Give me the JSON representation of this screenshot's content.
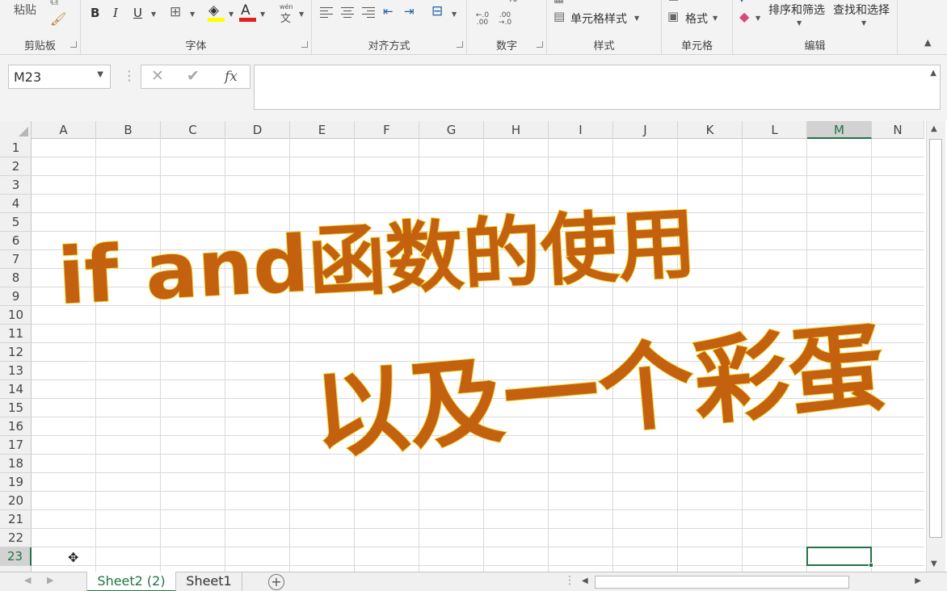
{
  "ribbon": {
    "clipboard": {
      "paste_label": "粘贴",
      "group_label": "剪贴板"
    },
    "font": {
      "bold": "B",
      "italic": "I",
      "underline": "U",
      "font_color_glyph": "A",
      "phonetic_glyph": "wén",
      "phonetic_char": "文",
      "group_label": "字体"
    },
    "alignment": {
      "group_label": "对齐方式"
    },
    "number": {
      "percent": "%",
      "inc_decimal": "←.0 .00",
      "dec_decimal": ".00 →.0",
      "group_label": "数字"
    },
    "styles": {
      "cell_styles": "单元格样式",
      "group_label": "样式"
    },
    "cells": {
      "format": "格式",
      "group_label": "单元格"
    },
    "editing": {
      "sort_filter": "排序和筛选",
      "find_select": "查找和选择",
      "group_label": "编辑"
    },
    "colors": {
      "fill_color": "#ffff00",
      "font_color": "#e0211c"
    }
  },
  "formula_bar": {
    "name_box": "M23",
    "separator": "⋮",
    "cancel_icon": "✕",
    "enter_icon": "✔",
    "fx_label": "fx",
    "formula_value": ""
  },
  "grid": {
    "columns": [
      "A",
      "B",
      "C",
      "D",
      "E",
      "F",
      "G",
      "H",
      "I",
      "J",
      "K",
      "L",
      "M",
      "N"
    ],
    "rows": [
      "1",
      "2",
      "3",
      "4",
      "5",
      "6",
      "7",
      "8",
      "9",
      "10",
      "11",
      "12",
      "13",
      "14",
      "15",
      "16",
      "17",
      "18",
      "19",
      "20",
      "21",
      "22",
      "23"
    ],
    "active_column": "M",
    "active_row": "23"
  },
  "overlay": {
    "line1": "if and函数的使用",
    "line2": "以及一个彩蛋",
    "fill_color": "#c4610f",
    "stroke_color": "#f4dc4c"
  },
  "sheets": {
    "tabs": [
      {
        "label": "Sheet2 (2)",
        "active": true
      },
      {
        "label": "Sheet1",
        "active": false
      }
    ],
    "add_icon": "+"
  }
}
